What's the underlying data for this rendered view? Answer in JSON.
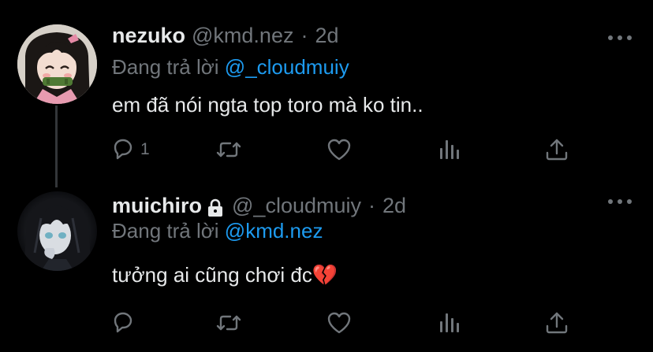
{
  "tweets": [
    {
      "name": "nezuko",
      "handle": "@kmd.nez",
      "separator": "·",
      "time": "2d",
      "replying_label": "Đang trả lời",
      "replying_to": "@_cloudmuiy",
      "text": "em đã nói ngta top toro mà ko tin..",
      "reply_count": "1",
      "protected": false
    },
    {
      "name": "muichiro",
      "handle": "@_cloudmuiy",
      "separator": "·",
      "time": "2d",
      "replying_label": "Đang trả lời",
      "replying_to": "@kmd.nez",
      "text": "tưởng ai cũng chơi đc💔",
      "reply_count": "",
      "protected": true
    }
  ],
  "colors": {
    "background": "#000000",
    "text_primary": "#e7e9ea",
    "text_secondary": "#71767b",
    "accent": "#1d9bf0",
    "thread_line": "#333639"
  },
  "icons": [
    "avatar-image",
    "lock-icon",
    "more-icon",
    "reply-icon",
    "retweet-icon",
    "like-icon",
    "views-icon",
    "share-icon"
  ]
}
